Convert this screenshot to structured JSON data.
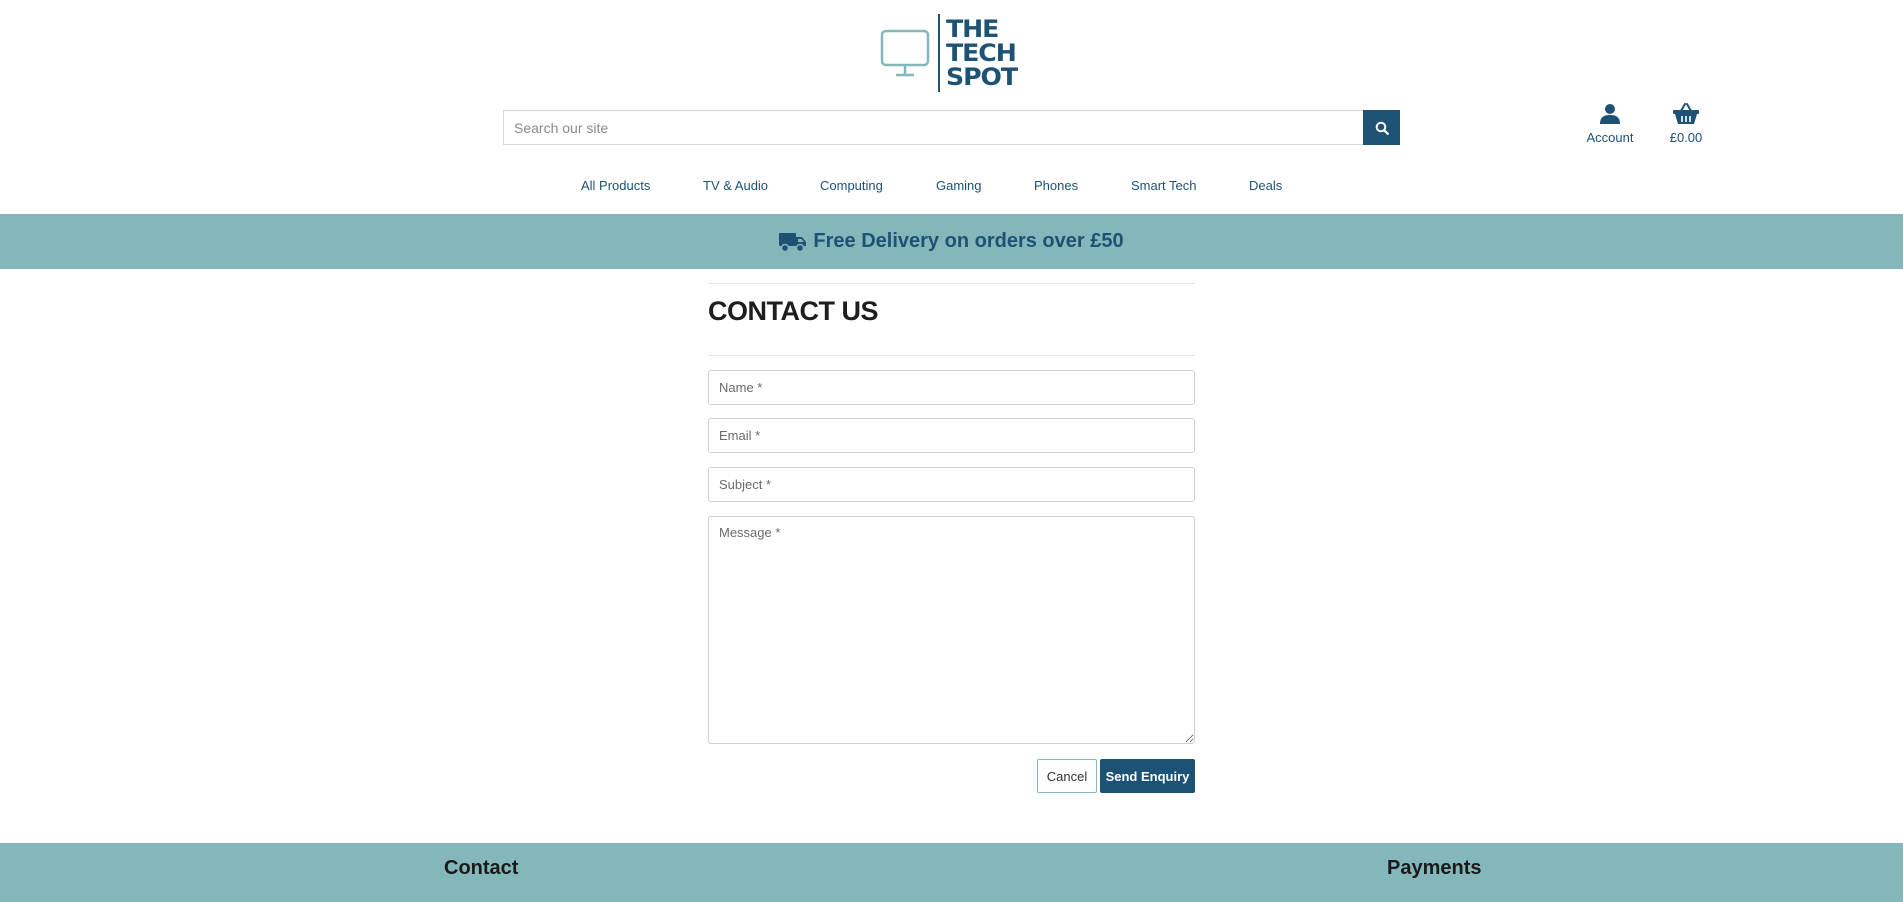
{
  "brand": {
    "logo_lines": [
      "THE",
      "TECH",
      "SPOT"
    ],
    "primary_color": "#1d5275",
    "accent_color": "#84b7b9"
  },
  "search": {
    "placeholder": "Search our site",
    "icon": "search-icon"
  },
  "header_actions": {
    "account_label": "Account",
    "account_icon": "user-icon",
    "basket_label": "£0.00",
    "basket_icon": "basket-icon"
  },
  "nav": {
    "items": [
      "All Products",
      "TV & Audio",
      "Computing",
      "Gaming",
      "Phones",
      "Smart Tech",
      "Deals"
    ]
  },
  "banner": {
    "icon": "delivery-truck-icon",
    "text": "Free Delivery on orders over £50"
  },
  "contact_form": {
    "title": "CONTACT US",
    "name_placeholder": "Name *",
    "email_placeholder": "Email *",
    "subject_placeholder": "Subject *",
    "message_placeholder": "Message *",
    "cancel_label": "Cancel",
    "submit_label": "Send Enquiry"
  },
  "footer": {
    "contact_heading": "Contact",
    "payments_heading": "Payments"
  }
}
